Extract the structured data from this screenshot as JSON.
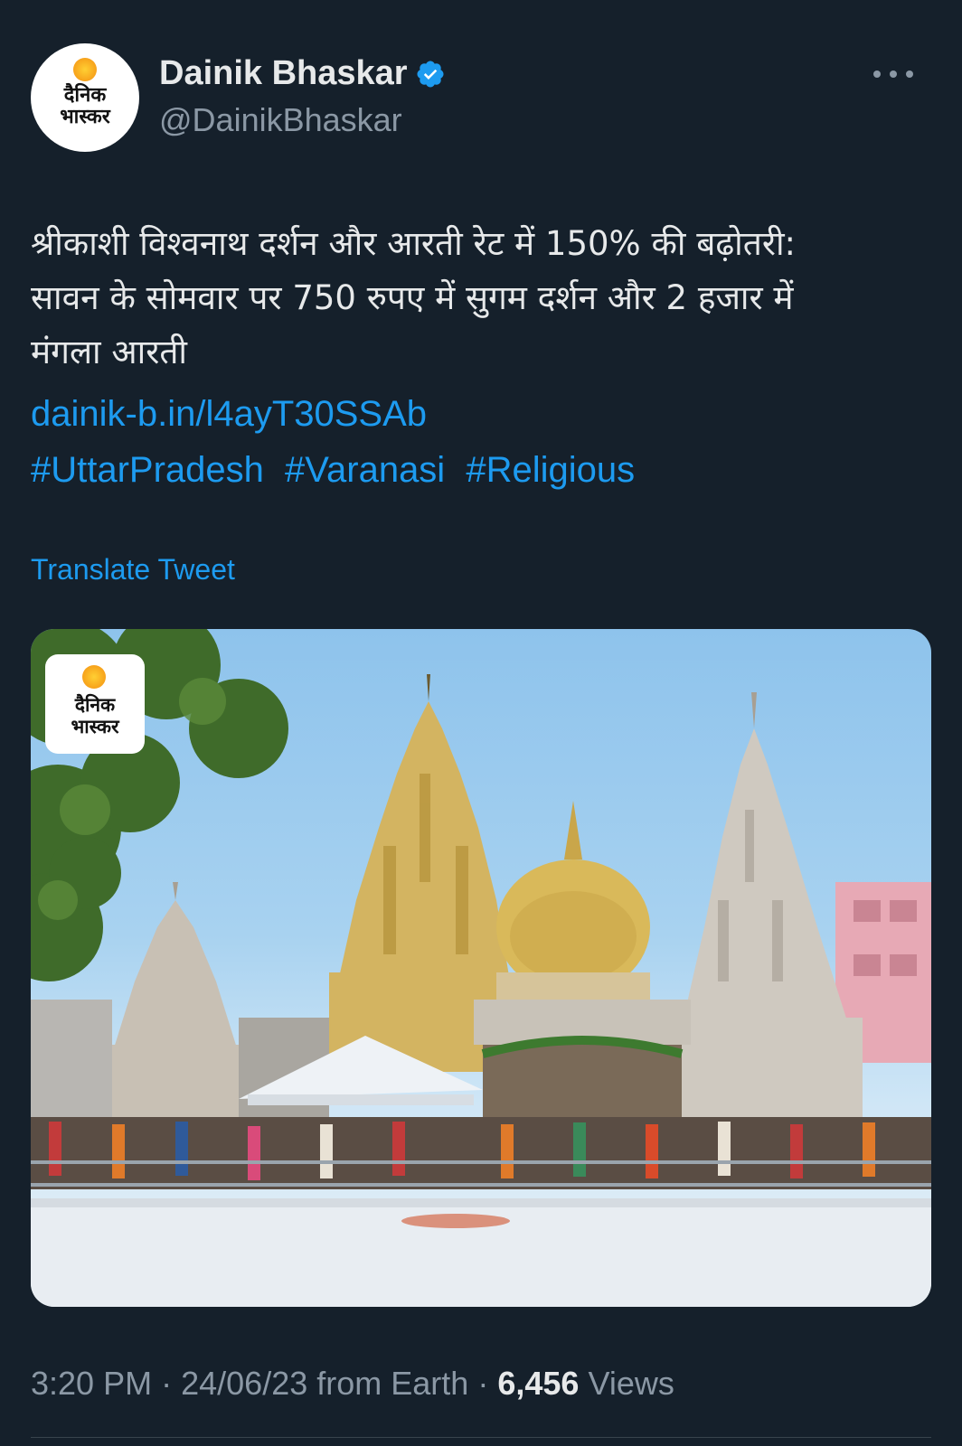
{
  "author": {
    "display_name": "Dainik Bhaskar",
    "handle": "@DainikBhaskar",
    "avatar_logo_line1": "दैनिक",
    "avatar_logo_line2": "भास्कर",
    "verified_icon": "verified-badge-icon",
    "verified_color": "#1d9bf0"
  },
  "menu": {
    "icon": "more-options-icon"
  },
  "tweet": {
    "text_line1": "श्रीकाशी विश्वनाथ दर्शन और आरती रेट में 150% की बढ़ोतरी:",
    "text_line2": "सावन के सोमवार पर 750 रुपए में सुगम दर्शन और 2 हजार में",
    "text_line3": "मंगला आरती",
    "link": "dainik-b.in/l4ayT30SSAb",
    "hashtags": [
      "#UttarPradesh",
      "#Varanasi",
      "#Religious"
    ],
    "translate_label": "Translate Tweet"
  },
  "media": {
    "watermark_line1": "दैनिक",
    "watermark_line2": "भास्कर"
  },
  "meta": {
    "time": "3:20 PM",
    "separator": "·",
    "date": "24/06/23",
    "source": "from Earth",
    "views_count": "6,456",
    "views_label": "Views"
  },
  "colors": {
    "background": "#15202b",
    "accent": "#1d9bf0",
    "text_primary": "#e7e9ea",
    "text_secondary": "#8b98a5"
  }
}
